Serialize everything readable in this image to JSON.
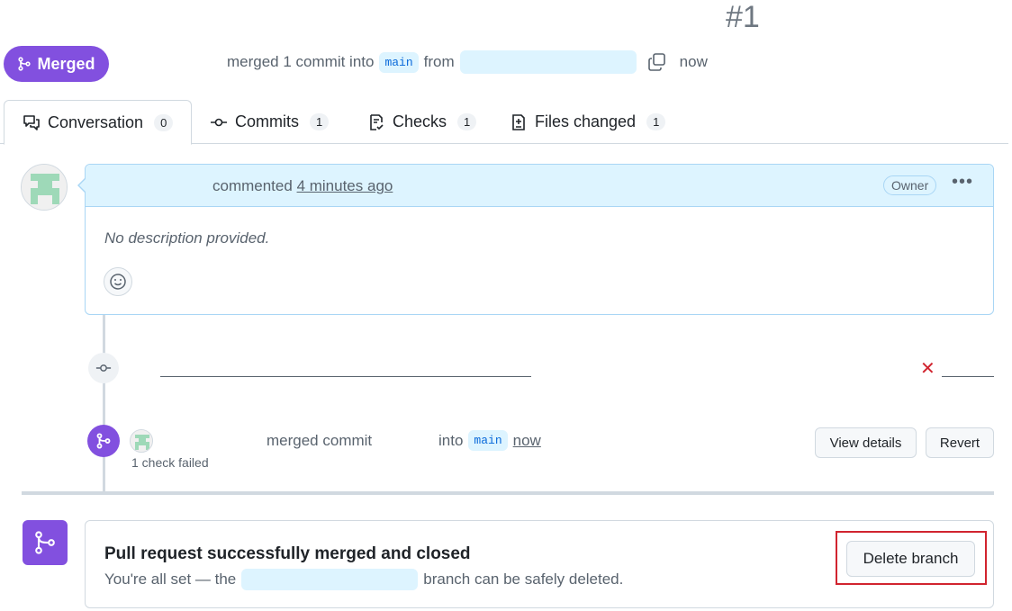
{
  "pr": {
    "number": "#1"
  },
  "header": {
    "status_label": "Merged",
    "merged_text": "merged 1 commit into",
    "base_branch": "main",
    "from_text": "from",
    "time": "now"
  },
  "tabs": [
    {
      "label": "Conversation",
      "count": "0",
      "icon": "comment-discussion-icon"
    },
    {
      "label": "Commits",
      "count": "1",
      "icon": "git-commit-icon"
    },
    {
      "label": "Checks",
      "count": "1",
      "icon": "checklist-icon"
    },
    {
      "label": "Files changed",
      "count": "1",
      "icon": "file-diff-icon"
    }
  ],
  "comment": {
    "action": "commented",
    "time": "4 minutes ago",
    "role_badge": "Owner",
    "body": "No description provided."
  },
  "merge_event": {
    "check_status": "1 check failed",
    "action": "merged commit",
    "into": "into",
    "branch": "main",
    "time": "now",
    "view_details_label": "View details",
    "revert_label": "Revert"
  },
  "merge_panel": {
    "title": "Pull request successfully merged and closed",
    "sub_prefix": "You're all set — the",
    "sub_suffix": "branch can be safely deleted.",
    "delete_label": "Delete branch"
  },
  "colors": {
    "merged_purple": "#8250df",
    "accent_blue": "#0969da",
    "highlight_blue": "#ddf4ff",
    "fail_red": "#d1242f"
  }
}
